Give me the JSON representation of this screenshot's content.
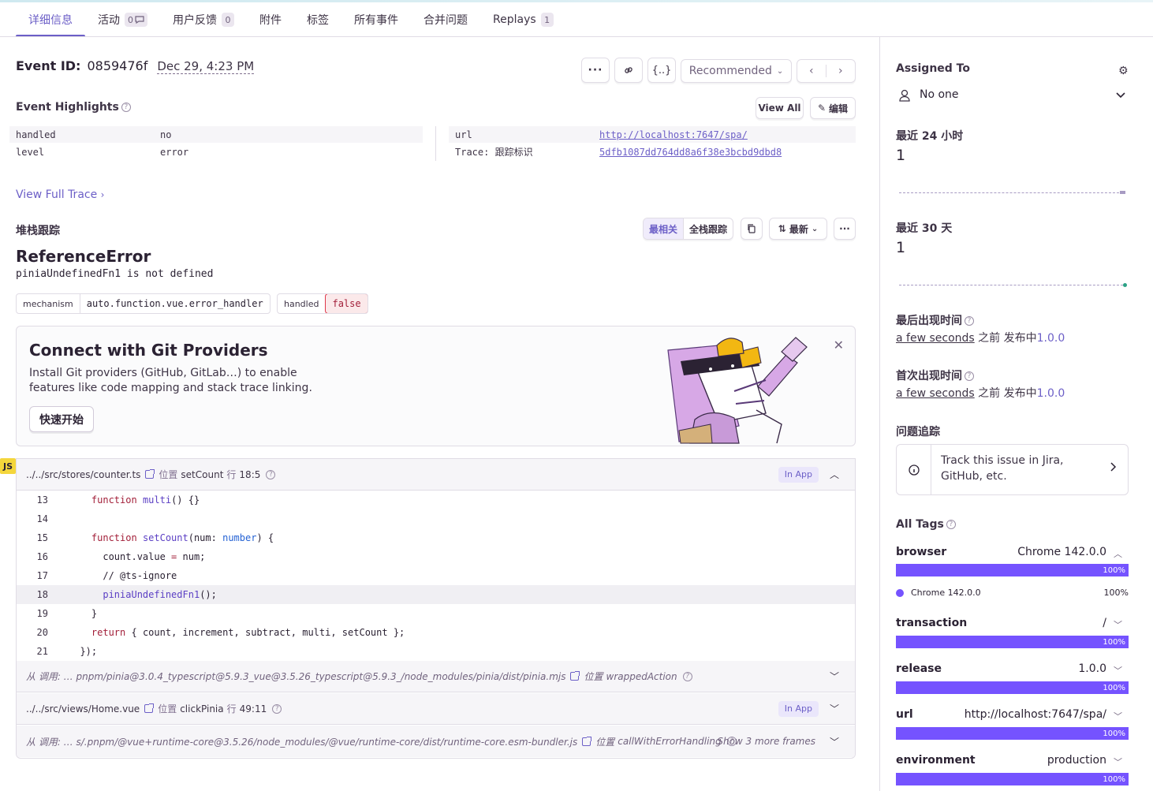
{
  "tabs": [
    {
      "label": "详细信息",
      "count": ""
    },
    {
      "label": "活动",
      "count": "0"
    },
    {
      "label": "用户反馈",
      "count": "0"
    },
    {
      "label": "附件",
      "count": ""
    },
    {
      "label": "标签",
      "count": ""
    },
    {
      "label": "所有事件",
      "count": ""
    },
    {
      "label": "合并问题",
      "count": ""
    },
    {
      "label": "Replays",
      "count": "1"
    }
  ],
  "event": {
    "id_label": "Event ID:",
    "id": "0859476f",
    "date": "Dec 29, 4:23 PM",
    "sort_label": "Recommended"
  },
  "highlights": {
    "title": "Event Highlights",
    "view_all": "View All",
    "edit": "编辑",
    "left": [
      {
        "key": "handled",
        "value": "no"
      },
      {
        "key": "level",
        "value": "error"
      }
    ],
    "right": [
      {
        "key": "url",
        "value": "http://localhost:7647/spa/"
      },
      {
        "key": "Trace: 跟踪标识",
        "value": "5dfb1087dd764dd8a6f38e3bcbd9dbd8"
      }
    ]
  },
  "view_full_trace": "View Full Trace",
  "stack": {
    "title": "堆栈跟踪",
    "seg_on": "最相关",
    "seg_off": "全栈跟踪",
    "sort": "最新",
    "error_type": "ReferenceError",
    "error_message": "piniaUndefinedFn1 is not defined",
    "mechanism_key": "mechanism",
    "mechanism_value": "auto.function.vue.error_handler",
    "handled_key": "handled",
    "handled_value": "false"
  },
  "banner": {
    "title": "Connect with Git Providers",
    "text": "Install Git providers (GitHub, GitLab…) to enable features like code mapping and stack trace linking.",
    "button": "快速开始"
  },
  "frames": {
    "lang_badge": "JS",
    "f1": {
      "path": "../../src/stores/counter.ts",
      "at": "位置",
      "func": "setCount",
      "line_label": "行",
      "line": "18:5",
      "tag": "In App"
    },
    "code": [
      {
        "n": "13",
        "t": "    function multi() {}"
      },
      {
        "n": "14",
        "t": ""
      },
      {
        "n": "15",
        "t": "    function setCount(num: number) {"
      },
      {
        "n": "16",
        "t": "      count.value = num;"
      },
      {
        "n": "17",
        "t": "      // @ts-ignore"
      },
      {
        "n": "18",
        "t": "      piniaUndefinedFn1();"
      },
      {
        "n": "19",
        "t": "    }"
      },
      {
        "n": "20",
        "t": "    return { count, increment, subtract, multi, setCount };"
      },
      {
        "n": "21",
        "t": "  });"
      }
    ],
    "f2": {
      "prefix": "从 调用: … pnpm/pinia@3.0.4_typescript@5.9.3_vue@3.5.26_typescript@5.9.3_/node_modules/pinia/dist/pinia.mjs",
      "at": "位置",
      "func": "wrappedAction"
    },
    "f3": {
      "path": "../../src/views/Home.vue",
      "at": "位置",
      "func": "clickPinia",
      "line_label": "行",
      "line": "49:11",
      "tag": "In App"
    },
    "f4": {
      "prefix": "从 调用: … s/.pnpm/@vue+runtime-core@3.5.26/node_modules/@vue/runtime-core/dist/runtime-core.esm-bundler.js",
      "at": "位置",
      "func": "callWithErrorHandling",
      "more": "Show 3 more frames"
    }
  },
  "sidebar": {
    "assigned_title": "Assigned To",
    "assigned_value": "No one",
    "last24_title": "最近 24 小时",
    "last24_value": "1",
    "last30_title": "最近 30 天",
    "last30_value": "1",
    "last_seen_title": "最后出现时间",
    "first_seen_title": "首次出现时间",
    "seen_ago": "a few seconds",
    "seen_mid": " 之前 发布中",
    "seen_release": "1.0.0",
    "issue_tracking_title": "问题追踪",
    "track_text": "Track this issue in Jira, GitHub, etc.",
    "all_tags_title": "All Tags",
    "tags": [
      {
        "key": "browser",
        "value": "Chrome 142.0.0",
        "pct": "100%"
      },
      {
        "key": "transaction",
        "value": "/",
        "pct": "100%"
      },
      {
        "key": "release",
        "value": "1.0.0",
        "pct": "100%"
      },
      {
        "key": "url",
        "value": "http://localhost:7647/spa/",
        "pct": "100%"
      },
      {
        "key": "environment",
        "value": "production",
        "pct": "100%"
      }
    ],
    "browser_detail": {
      "name": "Chrome 142.0.0",
      "pct": "100%"
    }
  },
  "colors": {
    "accent": "#6c5fc7",
    "bar": "#7553ff",
    "error": "#e0374a"
  }
}
